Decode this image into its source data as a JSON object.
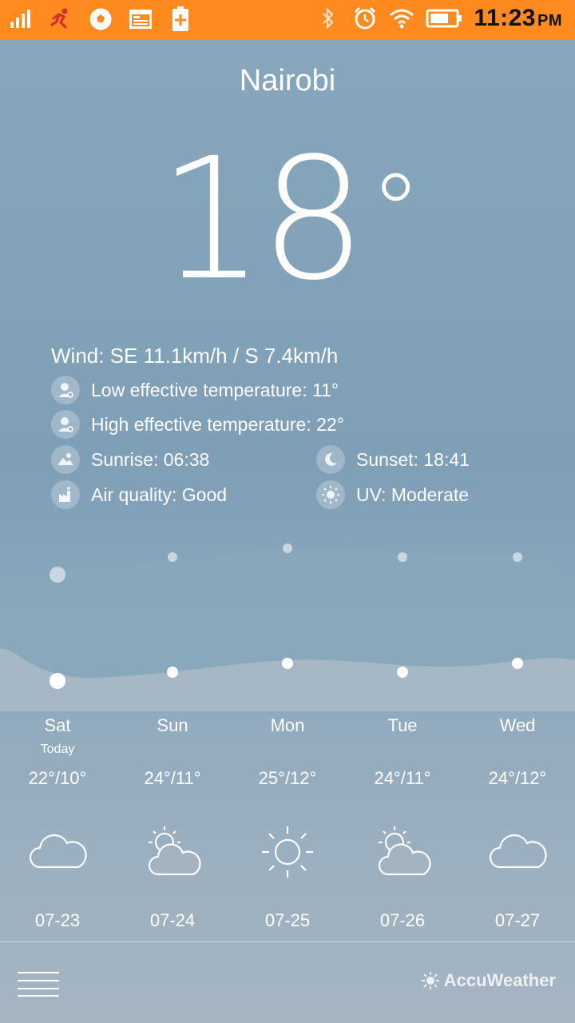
{
  "status_bar": {
    "time": "11:23",
    "ampm": "PM",
    "left_icons": [
      "signal-icon",
      "runner-icon",
      "soccer-icon",
      "calendar-icon",
      "battery-plus-icon"
    ],
    "right_icons": [
      "bluetooth-icon",
      "alarm-icon",
      "wifi-icon",
      "battery-icon"
    ],
    "accent": "#ff8a1f"
  },
  "location": {
    "city": "Nairobi"
  },
  "current": {
    "temperature": "18",
    "degree": "°",
    "wind": "Wind: SE 11.1km/h / S 7.4km/h",
    "low_effective": "Low effective temperature: 11°",
    "high_effective": "High effective temperature: 22°",
    "sunrise": "Sunrise: 06:38",
    "sunset": "Sunset: 18:41",
    "air_quality": "Air quality: Good",
    "uv": "UV: Moderate"
  },
  "forecast": [
    {
      "day": "Sat",
      "sub": "Today",
      "range": "22°/10°",
      "icon": "cloud-icon",
      "date": "07-23"
    },
    {
      "day": "Sun",
      "sub": "",
      "range": "24°/11°",
      "icon": "partly-sunny-icon",
      "date": "07-24"
    },
    {
      "day": "Mon",
      "sub": "",
      "range": "25°/12°",
      "icon": "sun-icon",
      "date": "07-25"
    },
    {
      "day": "Tue",
      "sub": "",
      "range": "24°/11°",
      "icon": "partly-sunny-icon",
      "date": "07-26"
    },
    {
      "day": "Wed",
      "sub": "",
      "range": "24°/12°",
      "icon": "cloud-icon",
      "date": "07-27"
    }
  ],
  "footer": {
    "brand": "AccuWeather"
  }
}
